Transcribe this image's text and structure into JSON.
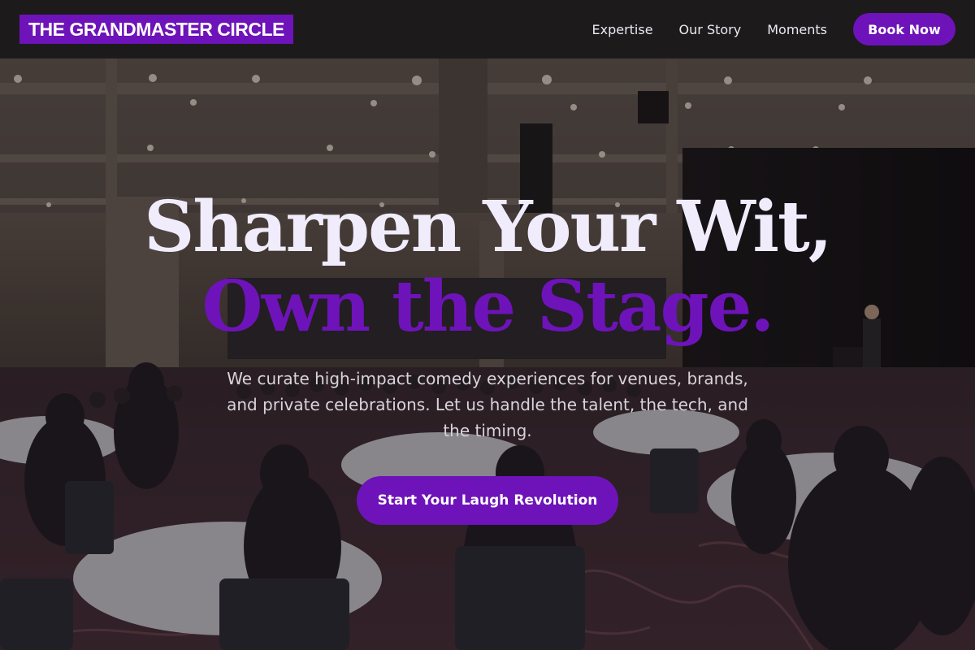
{
  "brand": {
    "name": "THE GRANDMASTER CIRCLE",
    "accent_color": "#6e13b9"
  },
  "nav": {
    "links": [
      "Expertise",
      "Our Story",
      "Moments"
    ],
    "cta_label": "Book Now"
  },
  "hero": {
    "headline_line1": "Sharpen Your Wit,",
    "headline_line2": "Own the Stage.",
    "subtext": "We curate high-impact comedy experiences for venues, brands, and private celebrations. Let us handle the talent, the tech, and the timing.",
    "cta_label": "Start Your Laugh Revolution",
    "background": "photo of a conference ballroom with round banquet tables, seated audience, and a speaker at a podium on stage"
  }
}
